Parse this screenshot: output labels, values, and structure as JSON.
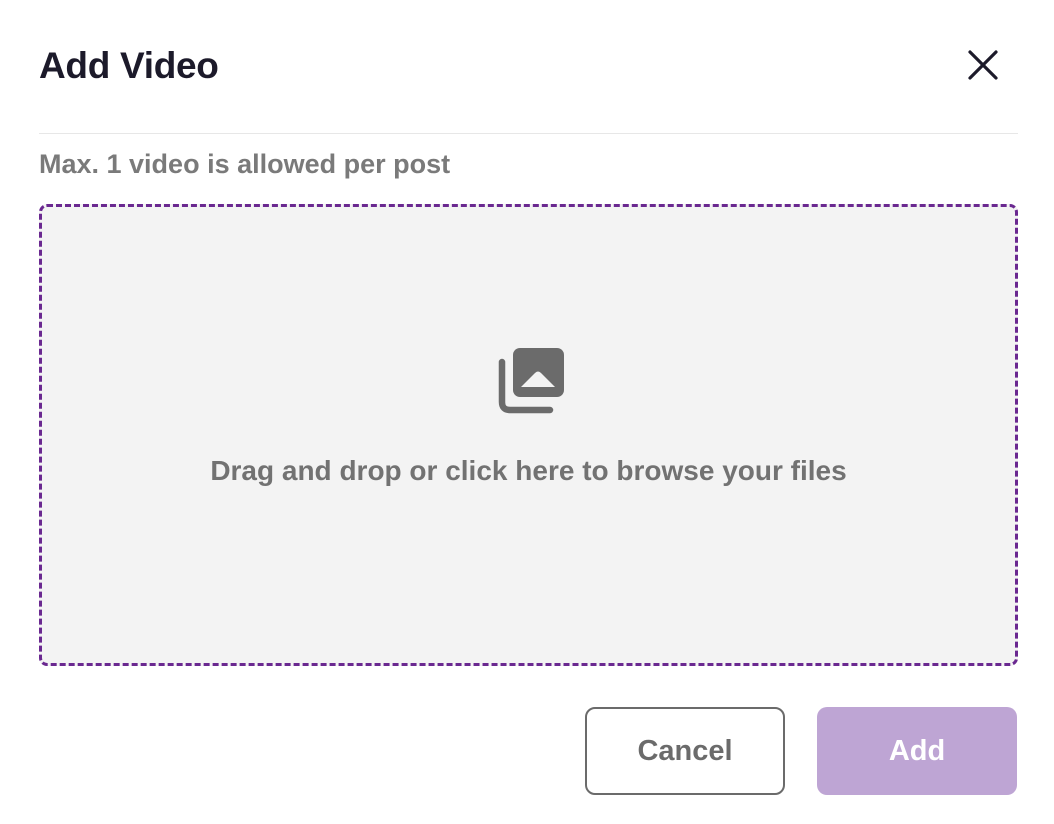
{
  "dialog": {
    "title": "Add Video",
    "subtitle": "Max. 1 video is allowed per post",
    "close_icon": "close-icon"
  },
  "dropzone": {
    "icon": "photo-library-icon",
    "text": "Drag and drop or click here to browse your files",
    "border_color": "#6a2890",
    "background": "#f3f3f3"
  },
  "actions": {
    "cancel_label": "Cancel",
    "add_label": "Add",
    "add_color": "#bea5d4"
  }
}
